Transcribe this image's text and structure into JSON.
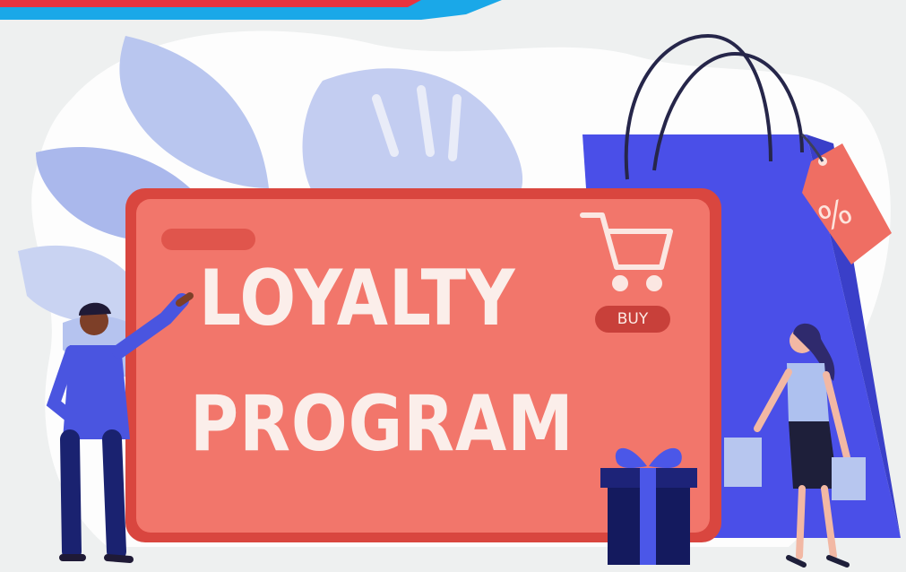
{
  "banner": {
    "title_line1": "LOYALTY",
    "title_line2": "PROGRAM",
    "buy_label": "BUY",
    "discount_tag": "%"
  },
  "colors": {
    "background": "#eef0f0",
    "top_banner_blue": "#1aa8e8",
    "top_banner_red": "#e8333f",
    "screen_coral": "#f2766b",
    "screen_border": "#d9463f",
    "bag_blue": "#4a4fe8",
    "leaf_light": "#c9d3f2",
    "leaf_mid": "#aab8ec"
  },
  "icons": [
    "shopping-cart-icon",
    "gift-box-icon",
    "shopping-bag-icon",
    "price-tag-icon"
  ]
}
